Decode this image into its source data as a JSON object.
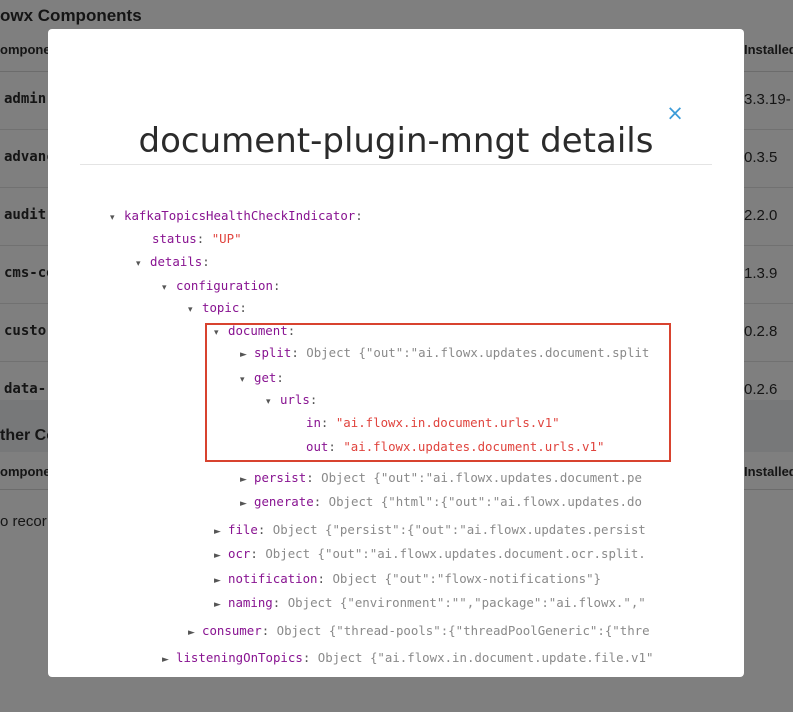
{
  "background": {
    "title": "owx Components",
    "columns": {
      "component": "omponen",
      "installed": "Installed"
    },
    "rows": [
      {
        "name": "admin-",
        "version": "3.3.19-"
      },
      {
        "name": "advanc",
        "version": "0.3.5"
      },
      {
        "name": "audit-",
        "version": "2.2.0"
      },
      {
        "name": "cms-co",
        "version": "1.3.9"
      },
      {
        "name": "custo",
        "version": "0.2.8"
      },
      {
        "name": "data-",
        "version": "0.2.6"
      }
    ],
    "other_section": "ther Co",
    "other_columns": {
      "component": "omponen",
      "installed": "Installed"
    },
    "empty_text": "o recor"
  },
  "modal": {
    "title": "document-plugin-mngt details",
    "close_icon": "×",
    "highlight_color": "#d8432f"
  },
  "tree": [
    {
      "key": "kafkaTopicsHealthCheckIndicator",
      "arrow": "▾",
      "value": "",
      "value_type": ""
    },
    {
      "key": "status",
      "arrow": "",
      "value": "\"UP\"",
      "value_type": "string"
    },
    {
      "key": "details",
      "arrow": "▾",
      "value": "",
      "value_type": ""
    },
    {
      "key": "configuration",
      "arrow": "▾",
      "value": "",
      "value_type": ""
    },
    {
      "key": "topic",
      "arrow": "▾",
      "value": "",
      "value_type": ""
    },
    {
      "key": "document",
      "arrow": "▾",
      "value": "",
      "value_type": ""
    },
    {
      "key": "split",
      "arrow": "►",
      "value": "Object {\"out\":\"ai.flowx.updates.document.split",
      "value_type": "object"
    },
    {
      "key": "get",
      "arrow": "▾",
      "value": "",
      "value_type": ""
    },
    {
      "key": "urls",
      "arrow": "▾",
      "value": "",
      "value_type": ""
    },
    {
      "key": "in",
      "arrow": "",
      "value": "\"ai.flowx.in.document.urls.v1\"",
      "value_type": "string"
    },
    {
      "key": "out",
      "arrow": "",
      "value": "\"ai.flowx.updates.document.urls.v1\"",
      "value_type": "string"
    },
    {
      "key": "persist",
      "arrow": "►",
      "value": "Object {\"out\":\"ai.flowx.updates.document.pe",
      "value_type": "object"
    },
    {
      "key": "generate",
      "arrow": "►",
      "value": "Object {\"html\":{\"out\":\"ai.flowx.updates.do",
      "value_type": "object"
    },
    {
      "key": "file",
      "arrow": "►",
      "value": "Object {\"persist\":{\"out\":\"ai.flowx.updates.persist",
      "value_type": "object"
    },
    {
      "key": "ocr",
      "arrow": "►",
      "value": "Object {\"out\":\"ai.flowx.updates.document.ocr.split.",
      "value_type": "object"
    },
    {
      "key": "notification",
      "arrow": "►",
      "value": "Object {\"out\":\"flowx-notifications\"}",
      "value_type": "object"
    },
    {
      "key": "naming",
      "arrow": "►",
      "value": "Object {\"environment\":\"\",\"package\":\"ai.flowx.\",\"",
      "value_type": "object"
    },
    {
      "key": "consumer",
      "arrow": "►",
      "value": "Object {\"thread-pools\":{\"threadPoolGeneric\":{\"thre",
      "value_type": "object"
    },
    {
      "key": "listeningOnTopics",
      "arrow": "►",
      "value": "Object {\"ai.flowx.in.document.update.file.v1\"",
      "value_type": "object"
    }
  ]
}
